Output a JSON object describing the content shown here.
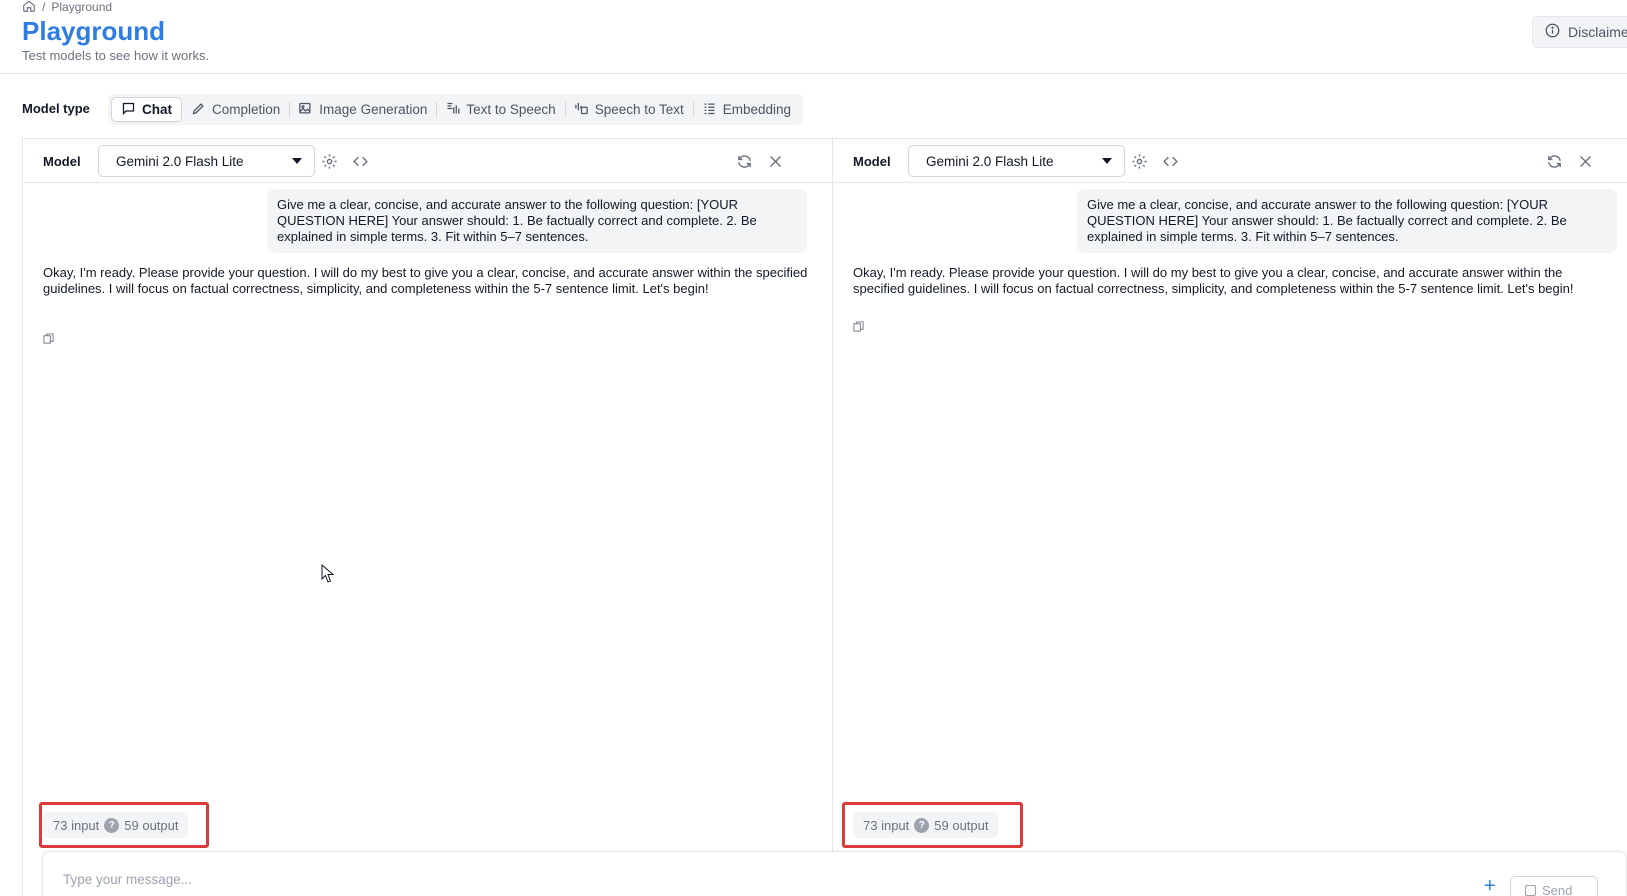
{
  "breadcrumb": {
    "home_icon": "home-icon",
    "separator": "/",
    "current": "Playground"
  },
  "header": {
    "title": "Playground",
    "subtitle": "Test models to see how it works.",
    "disclaimer_label": "Disclaimer"
  },
  "model_type": {
    "label": "Model type",
    "tabs": [
      {
        "label": "Chat",
        "icon": "chat-icon",
        "active": true
      },
      {
        "label": "Completion",
        "icon": "pencil-icon",
        "active": false
      },
      {
        "label": "Image Generation",
        "icon": "image-icon",
        "active": false
      },
      {
        "label": "Text to Speech",
        "icon": "speaker-icon",
        "active": false
      },
      {
        "label": "Speech to Text",
        "icon": "mic-icon",
        "active": false
      },
      {
        "label": "Embedding",
        "icon": "list-icon",
        "active": false
      }
    ]
  },
  "panels": [
    {
      "model_label": "Model",
      "selected_model": "Gemini 2.0 Flash Lite",
      "user_message": "Give me a clear, concise, and accurate answer to the following question: [YOUR QUESTION HERE] Your answer should: 1. Be factually correct and complete. 2. Be explained in simple terms. 3. Fit within 5–7 sentences.",
      "assistant_message": "Okay, I'm ready. Please provide your question. I will do my best to give you a clear, concise, and accurate answer within the specified guidelines. I will focus on factual correctness, simplicity, and completeness within the 5-7 sentence limit. Let's begin!",
      "tokens": {
        "input": "73 input",
        "help": "?",
        "output": "59 output"
      }
    },
    {
      "model_label": "Model",
      "selected_model": "Gemini 2.0 Flash Lite",
      "user_message": "Give me a clear, concise, and accurate answer to the following question: [YOUR QUESTION HERE] Your answer should: 1. Be factually correct and complete. 2. Be explained in simple terms. 3. Fit within 5–7 sentences.",
      "assistant_message": "Okay, I'm ready. Please provide your question. I will do my best to give you a clear, concise, and accurate answer within the specified guidelines. I will focus on factual correctness, simplicity, and completeness within the 5-7 sentence limit. Let's begin!",
      "tokens": {
        "input": "73 input",
        "help": "?",
        "output": "59 output"
      }
    }
  ],
  "composer": {
    "placeholder": "Type your message...",
    "add_label": "+",
    "send_label": "Send"
  },
  "colors": {
    "accent": "#2f7de1",
    "highlight": "#dc3b3b"
  }
}
